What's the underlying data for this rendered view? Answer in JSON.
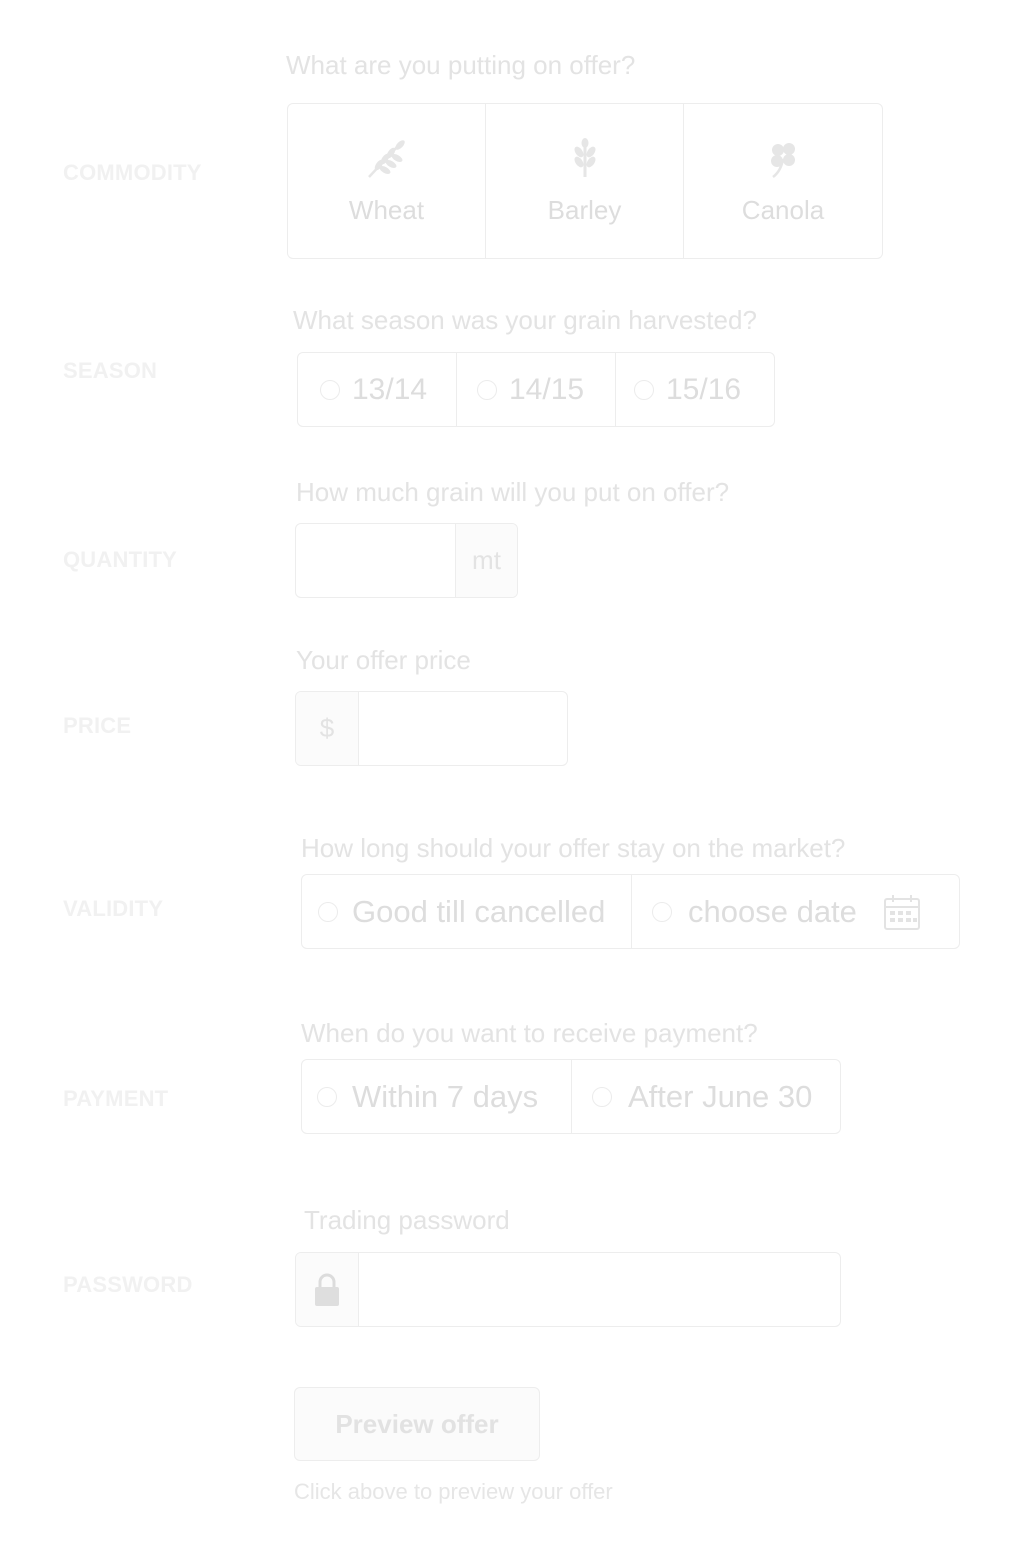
{
  "commodity": {
    "label": "COMMODITY",
    "question": "What are you putting on offer?",
    "options": [
      {
        "label": "Wheat",
        "icon": "wheat-icon"
      },
      {
        "label": "Barley",
        "icon": "barley-icon"
      },
      {
        "label": "Canola",
        "icon": "canola-icon"
      }
    ]
  },
  "season": {
    "label": "SEASON",
    "question": "What season was your grain harvested?",
    "options": [
      "13/14",
      "14/15",
      "15/16"
    ]
  },
  "quantity": {
    "label": "QUANTITY",
    "question": "How much grain will you put on offer?",
    "value": "",
    "unit": "mt"
  },
  "price": {
    "label": "PRICE",
    "question": "Your offer price",
    "currency": "$",
    "value": ""
  },
  "validity": {
    "label": "VALIDITY",
    "question": "How long should your offer stay on the market?",
    "options": [
      "Good till cancelled",
      "choose date"
    ],
    "date_icon": "calendar-icon"
  },
  "payment": {
    "label": "PAYMENT",
    "question": "When do you want to receive payment?",
    "options": [
      "Within 7 days",
      "After June 30"
    ]
  },
  "password": {
    "label": "PASSWORD",
    "question": "Trading password",
    "icon": "lock-icon",
    "value": ""
  },
  "actions": {
    "preview_label": "Preview offer",
    "hint": "Click above to preview your offer"
  },
  "colors": {
    "text": "#e0e0e0",
    "border": "#ededed",
    "addon_bg": "#fbfbfb"
  }
}
